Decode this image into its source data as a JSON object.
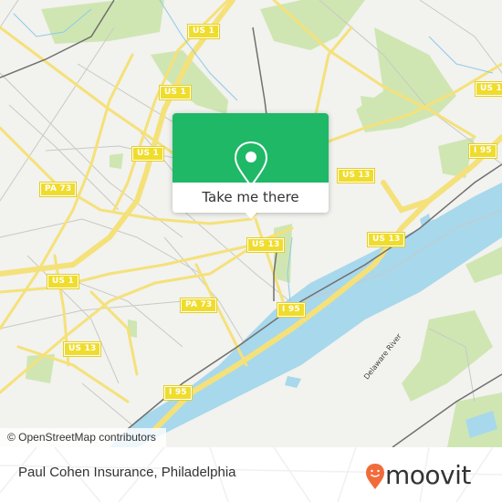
{
  "map": {
    "road_shields": [
      {
        "label": "US 1"
      },
      {
        "label": "US 1"
      },
      {
        "label": "US 1"
      },
      {
        "label": "US 1"
      },
      {
        "label": "PA 73"
      },
      {
        "label": "US 13"
      },
      {
        "label": "I 95"
      },
      {
        "label": "US 1"
      },
      {
        "label": "US 13"
      },
      {
        "label": "PA 73"
      },
      {
        "label": "US 13"
      },
      {
        "label": "I 95"
      },
      {
        "label": "I 95"
      },
      {
        "label": "US 13"
      }
    ],
    "water_label": "Delaware River",
    "attribution": "© OpenStreetMap contributors",
    "colors": {
      "land": "#f2f2ee",
      "water": "#a8d8ec",
      "park": "#cfe6b3",
      "major_road": "#f5e17a",
      "minor_road": "#c9c9c4",
      "rail": "#707070"
    }
  },
  "popup": {
    "icon": "map-pin-icon",
    "button_label": "Take me there",
    "accent": "#1fb866"
  },
  "footer": {
    "place_title": "Paul Cohen Insurance, Philadelphia",
    "brand": "moovit",
    "brand_color": "#f26b3a"
  }
}
